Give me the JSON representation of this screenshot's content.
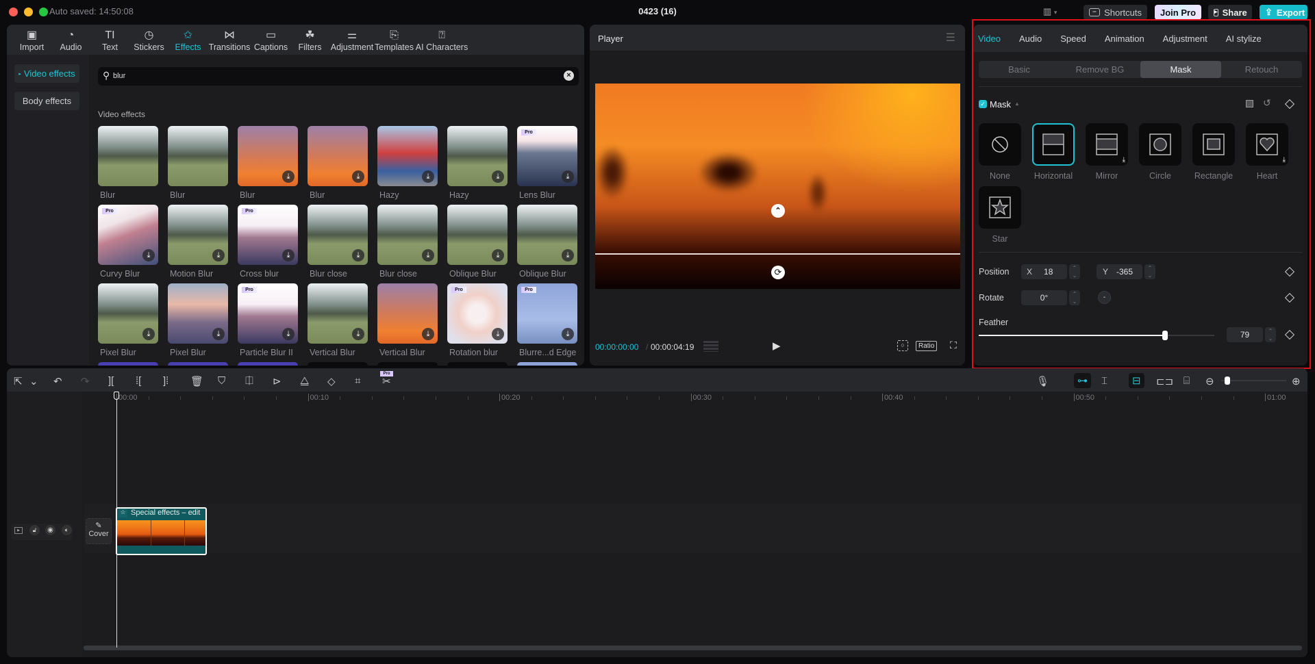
{
  "titlebar": {
    "autosave": "Auto saved: 14:50:08",
    "title": "0423 (16)",
    "shortcuts": "Shortcuts",
    "join_pro": "Join Pro",
    "share": "Share",
    "export": "Export",
    "colors": {
      "close": "#ff5f57",
      "minimize": "#febc2e",
      "maximize": "#28c840",
      "accent": "#1fc3d3"
    }
  },
  "media_tabs": [
    {
      "label": "Import",
      "icon": "import-icon"
    },
    {
      "label": "Audio",
      "icon": "audio-icon"
    },
    {
      "label": "Text",
      "icon": "text-icon"
    },
    {
      "label": "Stickers",
      "icon": "stickers-icon"
    },
    {
      "label": "Effects",
      "icon": "effects-icon",
      "active": true
    },
    {
      "label": "Transitions",
      "icon": "transitions-icon"
    },
    {
      "label": "Captions",
      "icon": "captions-icon"
    },
    {
      "label": "Filters",
      "icon": "filters-icon"
    },
    {
      "label": "Adjustment",
      "icon": "adjustment-icon"
    },
    {
      "label": "Templates",
      "icon": "templates-icon"
    },
    {
      "label": "AI Characters",
      "icon": "ai-characters-icon"
    }
  ],
  "effects_sidebar": {
    "video_effects": "Video effects",
    "body_effects": "Body effects"
  },
  "search": {
    "value": "blur"
  },
  "effects_section_title": "Video effects",
  "effects": [
    {
      "label": "Blur",
      "pro": false,
      "download": false,
      "theme": "forest"
    },
    {
      "label": "Blur",
      "pro": false,
      "download": false,
      "theme": "forest"
    },
    {
      "label": "Blur",
      "pro": false,
      "download": true,
      "theme": "sunset"
    },
    {
      "label": "Blur",
      "pro": false,
      "download": true,
      "theme": "sunset"
    },
    {
      "label": "Hazy",
      "pro": false,
      "download": true,
      "theme": "person"
    },
    {
      "label": "Hazy",
      "pro": false,
      "download": true,
      "theme": "forest"
    },
    {
      "label": "Lens Blur",
      "pro": true,
      "download": true,
      "theme": "city"
    },
    {
      "label": "Curvy Blur",
      "pro": true,
      "download": true,
      "theme": "swirl"
    },
    {
      "label": "Motion Blur",
      "pro": false,
      "download": true,
      "theme": "forest"
    },
    {
      "label": "Cross blur",
      "pro": true,
      "download": true,
      "theme": "streak"
    },
    {
      "label": "Blur close",
      "pro": false,
      "download": true,
      "theme": "forest"
    },
    {
      "label": "Blur close",
      "pro": false,
      "download": true,
      "theme": "forest"
    },
    {
      "label": "Oblique Blur",
      "pro": false,
      "download": true,
      "theme": "forest"
    },
    {
      "label": "Oblique Blur",
      "pro": false,
      "download": true,
      "theme": "forest"
    },
    {
      "label": "Pixel Blur",
      "pro": false,
      "download": true,
      "theme": "forest"
    },
    {
      "label": "Pixel Blur",
      "pro": false,
      "download": true,
      "theme": "dusk"
    },
    {
      "label": "Particle Blur II",
      "pro": true,
      "download": true,
      "theme": "streak"
    },
    {
      "label": "Vertical Blur",
      "pro": false,
      "download": true,
      "theme": "forest"
    },
    {
      "label": "Vertical Blur",
      "pro": false,
      "download": true,
      "theme": "sunset"
    },
    {
      "label": "Rotation blur",
      "pro": true,
      "download": true,
      "theme": "rotation"
    },
    {
      "label": "Blurre...d Edge",
      "pro": true,
      "download": true,
      "theme": "skate"
    }
  ],
  "player": {
    "title": "Player",
    "current_time": "00:00:00:00",
    "total_time": "00:00:04:19",
    "ratio": "Ratio"
  },
  "right_panel": {
    "tabs": [
      "Video",
      "Audio",
      "Speed",
      "Animation",
      "Adjustment",
      "AI stylize"
    ],
    "active_tab": "Video",
    "subtabs": [
      "Basic",
      "Remove BG",
      "Mask",
      "Retouch"
    ],
    "active_subtab": "Mask",
    "mask_label": "Mask",
    "mask_enabled": true,
    "shapes": [
      {
        "label": "None",
        "icon": "none-mask-icon"
      },
      {
        "label": "Horizontal",
        "icon": "horizontal-mask-icon",
        "selected": true
      },
      {
        "label": "Mirror",
        "icon": "mirror-mask-icon",
        "download": true
      },
      {
        "label": "Circle",
        "icon": "circle-mask-icon"
      },
      {
        "label": "Rectangle",
        "icon": "rectangle-mask-icon"
      },
      {
        "label": "Heart",
        "icon": "heart-mask-icon",
        "download": true
      },
      {
        "label": "Star",
        "icon": "star-mask-icon"
      }
    ],
    "position_label": "Position",
    "x_label": "X",
    "x_value": "18",
    "y_label": "Y",
    "y_value": "-365",
    "rotate_label": "Rotate",
    "rotate_value": "0°",
    "feather_label": "Feather",
    "feather_value": "79",
    "feather_fraction": 0.79
  },
  "timeline": {
    "ruler": [
      "00:00",
      "00:10",
      "00:20",
      "00:30",
      "00:40",
      "00:50",
      "01:00"
    ],
    "cover_label": "Cover",
    "clip_label": "Special effects – edit",
    "zoom_fraction": 0.05
  }
}
